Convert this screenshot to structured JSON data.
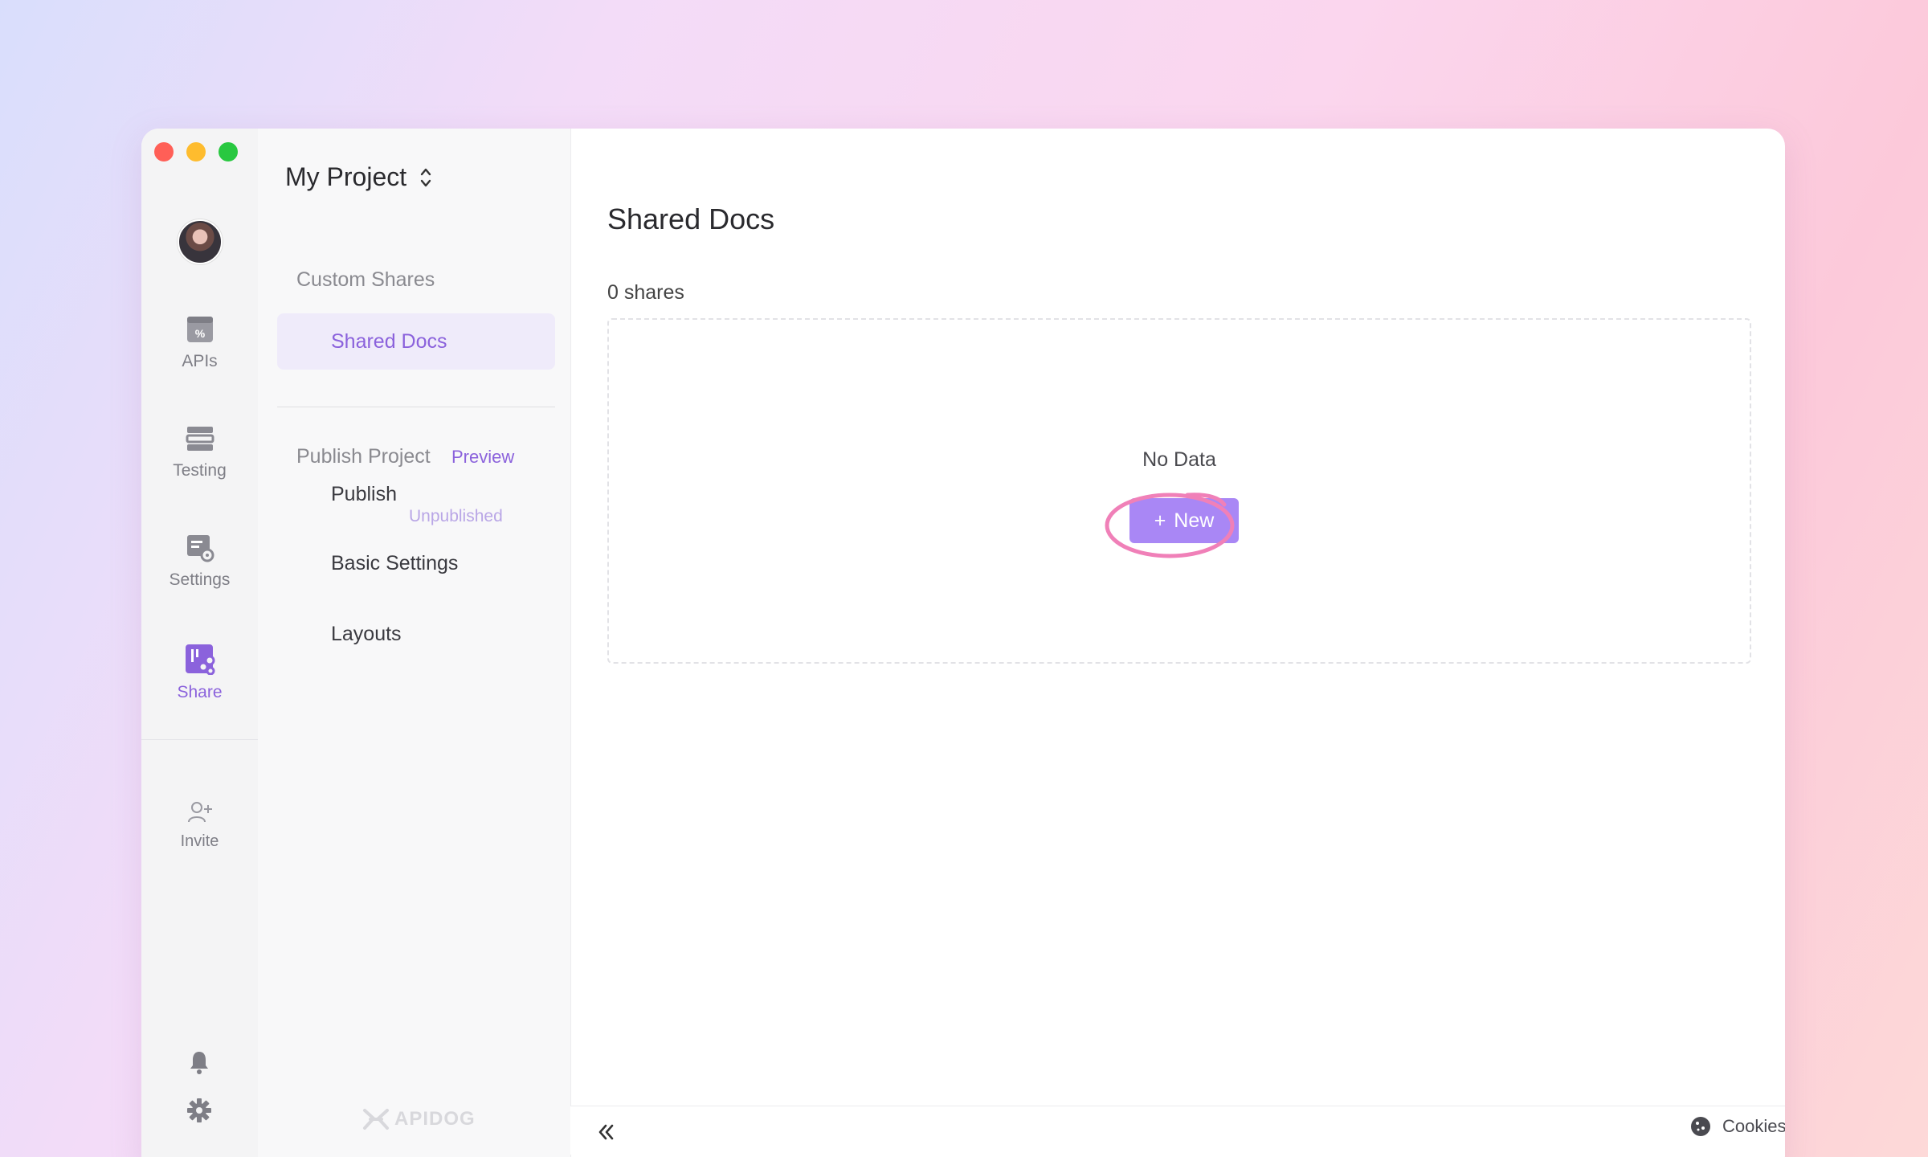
{
  "window": {
    "title": "Apidog"
  },
  "rail": {
    "items": [
      {
        "id": "apis",
        "label": "APIs",
        "icon": "apis-icon"
      },
      {
        "id": "testing",
        "label": "Testing",
        "icon": "testing-icon"
      },
      {
        "id": "settings",
        "label": "Settings",
        "icon": "settings-icon"
      },
      {
        "id": "share",
        "label": "Share",
        "icon": "share-icon",
        "active": true
      }
    ],
    "invite_label": "Invite",
    "bottom_icons": [
      "bell-icon",
      "gear-icon"
    ]
  },
  "subnav": {
    "project_name": "My Project",
    "custom_shares_heading": "Custom Shares",
    "shared_docs_label": "Shared Docs",
    "publish_project_heading": "Publish Project",
    "preview_link": "Preview",
    "publish_label": "Publish",
    "publish_status": "Unpublished",
    "basic_settings_label": "Basic Settings",
    "layouts_label": "Layouts",
    "brand": "APIDOG"
  },
  "main": {
    "title": "Shared Docs",
    "count_text": "0 shares",
    "empty_text": "No Data",
    "new_button_label": "New",
    "new_button_icon": "+"
  },
  "footer": {
    "cookies_label": "Cookies",
    "icons": [
      "collapse-icon",
      "cookie-icon",
      "shirt-icon",
      "help-icon"
    ]
  },
  "colors": {
    "accent": "#8b62dc",
    "button": "#a987f5",
    "highlight_ring": "#f080b8",
    "active_bg": "#efebfa"
  }
}
